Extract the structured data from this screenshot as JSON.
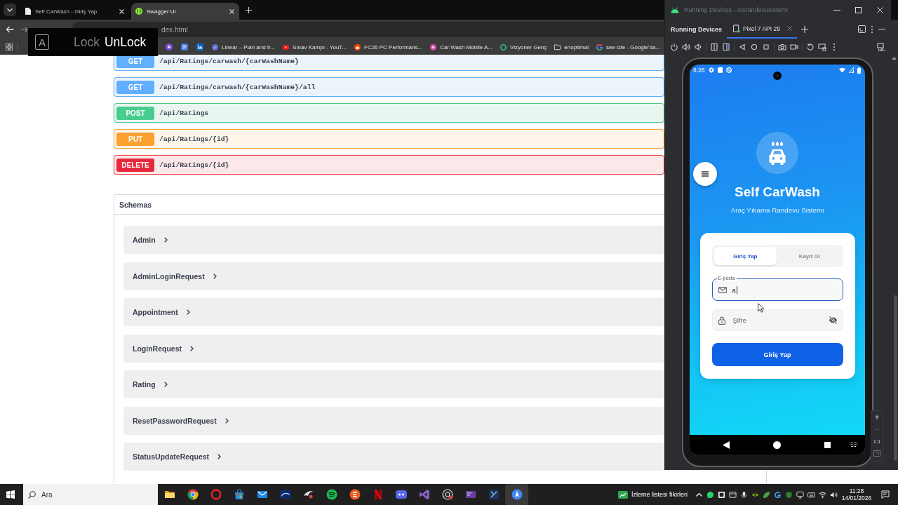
{
  "browser": {
    "tabs": [
      {
        "kind": "page",
        "title": "Self CarWash - Giriş Yap",
        "selected": false
      },
      {
        "kind": "brace",
        "title": "Swagger UI",
        "selected": true
      }
    ],
    "address": "dex.html",
    "bookmarks": [
      {
        "kind": "orb",
        "label": "Linear – Plan and b..."
      },
      {
        "kind": "play",
        "label": "Sınav Kampı - YouT..."
      },
      {
        "kind": "alien",
        "label": "FC26 PC Performans..."
      },
      {
        "kind": "flower",
        "label": "Car Wash Mobile A..."
      },
      {
        "kind": "ring",
        "label": "Vizyoner Genç"
      },
      {
        "kind": "folder",
        "label": "enoptimal"
      },
      {
        "kind": "letter",
        "label": "see izle - Google'da..."
      }
    ],
    "endpoints": [
      {
        "kind": "get",
        "method": "GET",
        "path": "/api/Ratings/carwash/{carWashName}"
      },
      {
        "kind": "get",
        "method": "GET",
        "path": "/api/Ratings/carwash/{carWashName}/all"
      },
      {
        "kind": "post",
        "method": "POST",
        "path": "/api/Ratings"
      },
      {
        "kind": "put",
        "method": "PUT",
        "path": "/api/Ratings/{id}"
      },
      {
        "kind": "delete",
        "method": "DELETE",
        "path": "/api/Ratings/{id}"
      }
    ],
    "schemas": {
      "title": "Schemas",
      "items": [
        "Admin",
        "AdminLoginRequest",
        "Appointment",
        "LoginRequest",
        "Rating",
        "ResetPasswordRequest",
        "StatusUpdateRequest"
      ]
    }
  },
  "recorder_overlay": {
    "key": "A",
    "options": [
      {
        "label": "Lock",
        "selected": false
      },
      {
        "label": "UnLock",
        "selected": true
      }
    ]
  },
  "device_window": {
    "title": "Running Devices - iosrandevusistemi",
    "panel_title": "Running Devices",
    "device_tab": {
      "label": "Pixel 7 API 29",
      "selected": true
    },
    "zoom_controls": [
      {
        "label": "+",
        "disabled": false
      },
      {
        "label": "−",
        "disabled": true
      },
      {
        "label": "1:1",
        "disabled": false
      }
    ]
  },
  "phone": {
    "time": "8:28",
    "app_title": "Self CarWash",
    "subtitle": "Araç Yıkama Randevu Sistemi",
    "auth_tabs": [
      {
        "label": "Giriş Yap",
        "selected": true
      },
      {
        "label": "Kayıt Ol",
        "selected": false
      }
    ],
    "email": {
      "label": "E-posta",
      "value": "a",
      "focused": true
    },
    "password": {
      "placeholder": "Şifre",
      "hidden": true
    },
    "submit": "Giriş Yap"
  },
  "taskbar": {
    "search": {
      "placeholder": "Ara"
    },
    "apps": [
      {
        "kind": "folder",
        "active": false
      },
      {
        "kind": "wheel",
        "active": false
      },
      {
        "kind": "ring",
        "active": false
      },
      {
        "kind": "bag",
        "active": false
      },
      {
        "kind": "mail",
        "active": false
      },
      {
        "kind": "arc",
        "active": false
      },
      {
        "kind": "swoosh",
        "active": false
      },
      {
        "kind": "waves",
        "active": false
      },
      {
        "kind": "disc",
        "active": false
      },
      {
        "kind": "ribbon",
        "active": false
      },
      {
        "kind": "gamepad",
        "active": false
      },
      {
        "kind": "loop",
        "active": false
      },
      {
        "kind": "lens",
        "active": false
      },
      {
        "kind": "tile",
        "active": false
      },
      {
        "kind": "frame",
        "active": false
      },
      {
        "kind": "compass",
        "active": true
      }
    ],
    "widget": "İzleme listesi fikirleri",
    "time": "11:28",
    "date": "14/01/2026"
  }
}
